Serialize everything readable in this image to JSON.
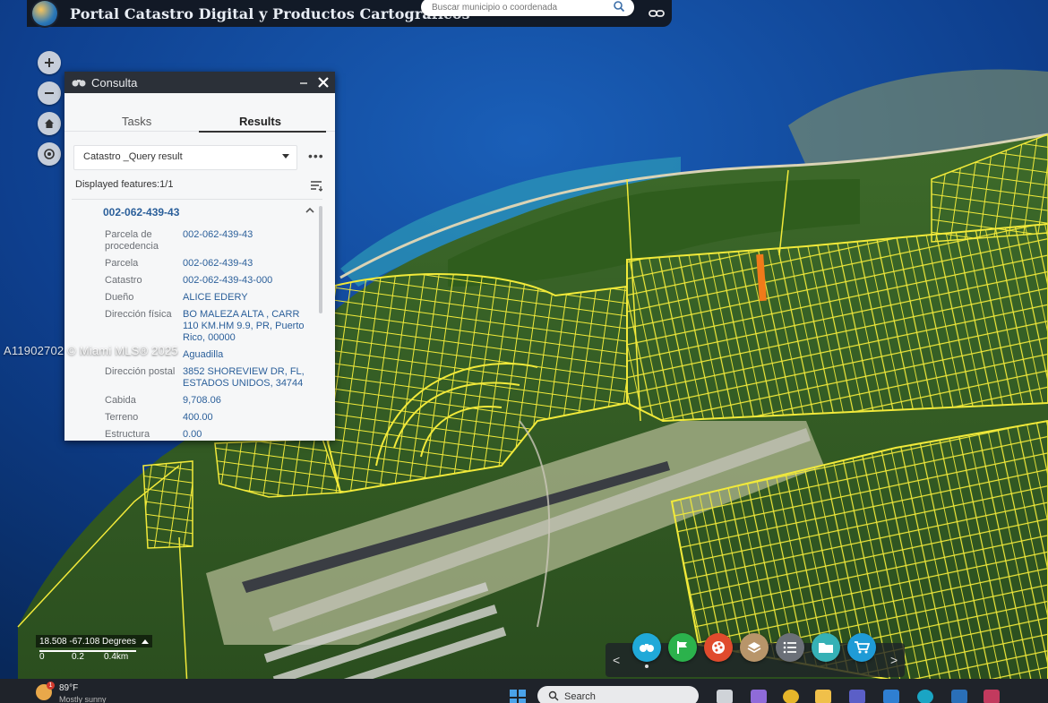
{
  "header": {
    "title": "Portal Catastro Digital y Productos Cartográficos",
    "search_placeholder": "Buscar municipio o coordenada",
    "icons": [
      "logo-icon",
      "search-icon",
      "link-icon"
    ]
  },
  "map_controls": {
    "zoom_in": "+",
    "zoom_out": "−",
    "icons": [
      "plus-icon",
      "minus-icon",
      "home-icon",
      "locate-icon"
    ]
  },
  "panel": {
    "title": "Consulta",
    "tabs": [
      {
        "label": "Tasks",
        "active": false
      },
      {
        "label": "Results",
        "active": true
      }
    ],
    "dropdown_value": "Catastro _Query result",
    "more_label": "•••",
    "displayed": "Displayed features:1/1",
    "feature_id": "002-062-439-43",
    "rows": [
      {
        "key": "Parcela de procedencia",
        "value": "002-062-439-43"
      },
      {
        "key": "Parcela",
        "value": "002-062-439-43"
      },
      {
        "key": "Catastro",
        "value": "002-062-439-43-000"
      },
      {
        "key": "Dueño",
        "value": "ALICE EDERY"
      },
      {
        "key": "Dirección física",
        "value": "BO MALEZA ALTA , CARR 110 KM.HM 9.9, PR, Puerto Rico, 00000"
      },
      {
        "key": "",
        "value": "Aguadilla"
      },
      {
        "key": "Dirección postal",
        "value": "3852 SHOREVIEW DR, FL, ESTADOS UNIDOS, 34744"
      },
      {
        "key": "Cabida",
        "value": "9,708.06"
      },
      {
        "key": "Terreno",
        "value": "400.00"
      },
      {
        "key": "Estructura",
        "value": "0.00"
      }
    ]
  },
  "watermark": "A11902702 © Miami MLS® 2025",
  "coords": {
    "text": "18.508 -67.108 Degrees",
    "scale": [
      "0",
      "0.2",
      "0.4km"
    ]
  },
  "toolbar": {
    "prev": "<",
    "next": ">",
    "tools": [
      {
        "name": "binoculars-icon",
        "color": "#20a9d8"
      },
      {
        "name": "flag-icon",
        "color": "#2bb24c"
      },
      {
        "name": "palette-icon",
        "color": "#e04b2d"
      },
      {
        "name": "layers-icon",
        "color": "#b8956a"
      },
      {
        "name": "list-icon",
        "color": "#6b7078"
      },
      {
        "name": "folder-icon",
        "color": "#36b1b6"
      },
      {
        "name": "cart-icon",
        "color": "#1f9bd6"
      }
    ]
  },
  "taskbar": {
    "temp": "89°F",
    "condition": "Mostly sunny",
    "badge": "1",
    "search_label": "Search",
    "apps": [
      {
        "name": "task-view-icon",
        "color": "#cfd3d8"
      },
      {
        "name": "copilot-icon",
        "color": "#8f6bd9"
      },
      {
        "name": "chrome-icon",
        "color": "#e5b52a"
      },
      {
        "name": "file-explorer-icon",
        "color": "#f0c04a"
      },
      {
        "name": "teams-icon",
        "color": "#5b5fc7"
      },
      {
        "name": "store-icon",
        "color": "#2f7fd2"
      },
      {
        "name": "edge-icon",
        "color": "#1aa5c4"
      },
      {
        "name": "app-icon",
        "color": "#2a6fb8"
      },
      {
        "name": "app-icon-2",
        "color": "#c23a5e"
      }
    ]
  },
  "colors": {
    "parcel_lines": "#f2ea3a",
    "selected_parcel": "#f07a1a",
    "ocean": "#0f4aa0",
    "land": "#3b6b2a"
  }
}
